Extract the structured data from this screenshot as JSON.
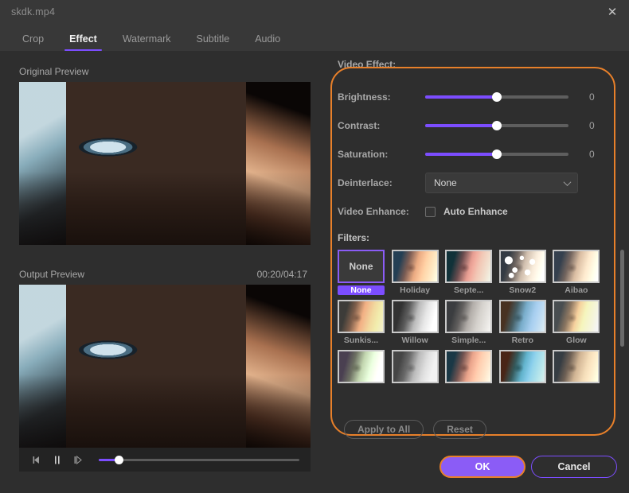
{
  "window": {
    "file_title": "skdk.mp4",
    "close_icon": "close-icon"
  },
  "tabs": [
    {
      "label": "Crop",
      "active": false
    },
    {
      "label": "Effect",
      "active": true
    },
    {
      "label": "Watermark",
      "active": false
    },
    {
      "label": "Subtitle",
      "active": false
    },
    {
      "label": "Audio",
      "active": false
    }
  ],
  "preview": {
    "original_label": "Original Preview",
    "output_label": "Output Preview",
    "timestamp": "00:20/04:17",
    "controls": {
      "prev_frame_icon": "step-backward-icon",
      "pause_icon": "pause-icon",
      "next_frame_icon": "step-forward-icon",
      "progress_percent": 10
    }
  },
  "panel": {
    "section_title": "Video Effect:",
    "highlight_color": "#e8802a",
    "accent_color": "#7c4dff",
    "sliders": [
      {
        "label": "Brightness:",
        "value": "0",
        "percent": 50
      },
      {
        "label": "Contrast:",
        "value": "0",
        "percent": 50
      },
      {
        "label": "Saturation:",
        "value": "0",
        "percent": 50
      }
    ],
    "deinterlace": {
      "label": "Deinterlace:",
      "selected": "None",
      "chevron_icon": "chevron-down-icon"
    },
    "video_enhance": {
      "label": "Video Enhance:",
      "checkbox_label": "Auto Enhance",
      "checked": false
    },
    "filters_label": "Filters:",
    "filters": [
      {
        "name": "None",
        "selected": true,
        "art": "none"
      },
      {
        "name": "Holiday",
        "selected": false,
        "art": "holiday"
      },
      {
        "name": "Septe...",
        "selected": false,
        "art": "septe"
      },
      {
        "name": "Snow2",
        "selected": false,
        "art": "snow2"
      },
      {
        "name": "Aibao",
        "selected": false,
        "art": "aibao"
      },
      {
        "name": "Sunkis...",
        "selected": false,
        "art": "sunkis"
      },
      {
        "name": "Willow",
        "selected": false,
        "art": "willow"
      },
      {
        "name": "Simple...",
        "selected": false,
        "art": "simple"
      },
      {
        "name": "Retro",
        "selected": false,
        "art": "retro"
      },
      {
        "name": "Glow",
        "selected": false,
        "art": "glow"
      },
      {
        "name": "",
        "selected": false,
        "art": "r3a"
      },
      {
        "name": "",
        "selected": false,
        "art": "r3b"
      },
      {
        "name": "",
        "selected": false,
        "art": "r3c"
      },
      {
        "name": "",
        "selected": false,
        "art": "r3d"
      },
      {
        "name": "",
        "selected": false,
        "art": "r3e"
      }
    ],
    "apply_to_all_label": "Apply to All",
    "reset_label": "Reset"
  },
  "footer": {
    "ok_label": "OK",
    "cancel_label": "Cancel"
  }
}
